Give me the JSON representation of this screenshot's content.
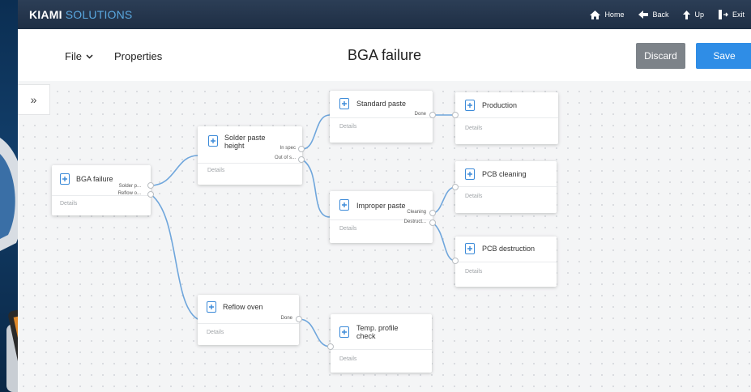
{
  "brand": {
    "part1": "KIAMI",
    "part2": "SOLUTIONS"
  },
  "topnav": [
    {
      "label": "Home",
      "icon": "home-icon"
    },
    {
      "label": "Back",
      "icon": "back-arrow-icon"
    },
    {
      "label": "Up",
      "icon": "up-arrow-icon"
    },
    {
      "label": "Exit",
      "icon": "exit-icon"
    }
  ],
  "toolbar": {
    "file_label": "File",
    "properties_label": "Properties",
    "title": "BGA failure",
    "discard_label": "Discard",
    "save_label": "Save",
    "expand_label": "»"
  },
  "nodes": {
    "bga_failure": {
      "title": "BGA failure",
      "details": "Details",
      "outputs": [
        "Solder p...",
        "Reflow o..."
      ]
    },
    "solder_paste_height": {
      "title": "Solder paste height",
      "details": "Details",
      "outputs": [
        "In spec",
        "Out of s..."
      ]
    },
    "standard_paste": {
      "title": "Standard paste",
      "details": "Details",
      "outputs": [
        "Done"
      ]
    },
    "production": {
      "title": "Production",
      "details": "Details",
      "outputs": []
    },
    "improper_paste": {
      "title": "Improper paste",
      "details": "Details",
      "outputs": [
        "Cleaning",
        "Destruct..."
      ]
    },
    "pcb_cleaning": {
      "title": "PCB cleaning",
      "details": "Details",
      "outputs": []
    },
    "pcb_destruction": {
      "title": "PCB destruction",
      "details": "Details",
      "outputs": []
    },
    "reflow_oven": {
      "title": "Reflow oven",
      "details": "Details",
      "outputs": [
        "Done"
      ]
    },
    "temp_profile_check": {
      "title": "Temp. profile check",
      "details": "Details",
      "outputs": []
    }
  },
  "colors": {
    "topbar": "#1e2e44",
    "brand_accent": "#5aa8e0",
    "save": "#2f8de6",
    "discard": "#7d8389",
    "connector": "#6fa6dc",
    "node_icon": "#3b8ad8"
  }
}
